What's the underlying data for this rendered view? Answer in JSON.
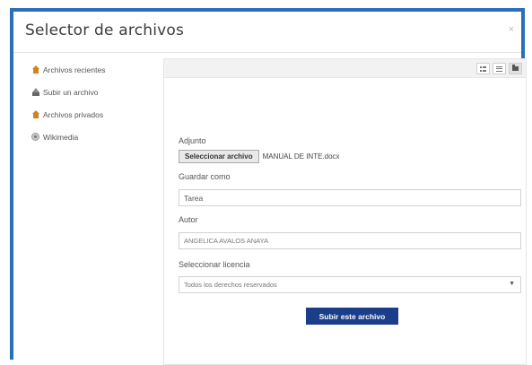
{
  "dialog": {
    "title": "Selector de archivos",
    "close": "×"
  },
  "sidebar": {
    "items": [
      {
        "label": "Archivos recientes",
        "icon": "home-icon"
      },
      {
        "label": "Subir un archivo",
        "icon": "upload-icon"
      },
      {
        "label": "Archivos privados",
        "icon": "home-icon"
      },
      {
        "label": "Wikimedia",
        "icon": "wikimedia-icon"
      }
    ]
  },
  "toolbar": {
    "views": [
      "grid-view-icon",
      "list-view-icon",
      "folder-view-icon"
    ]
  },
  "form": {
    "attachment_label": "Adjunto",
    "choose_file_label": "Seleccionar archivo",
    "file_name": "MANUAL DE INTE.docx",
    "save_as_label": "Guardar como",
    "save_as_value": "Tarea",
    "author_label": "Autor",
    "author_value": "ANGELICA AVALOS ANAYA",
    "license_label": "Seleccionar licencia",
    "license_value": "Todos los derechos reservados",
    "submit_label": "Subir este archivo"
  },
  "colors": {
    "frame_border": "#2b6fb8",
    "submit_bg": "#1b3e8b",
    "sidebar_icon": "#d4811f"
  }
}
